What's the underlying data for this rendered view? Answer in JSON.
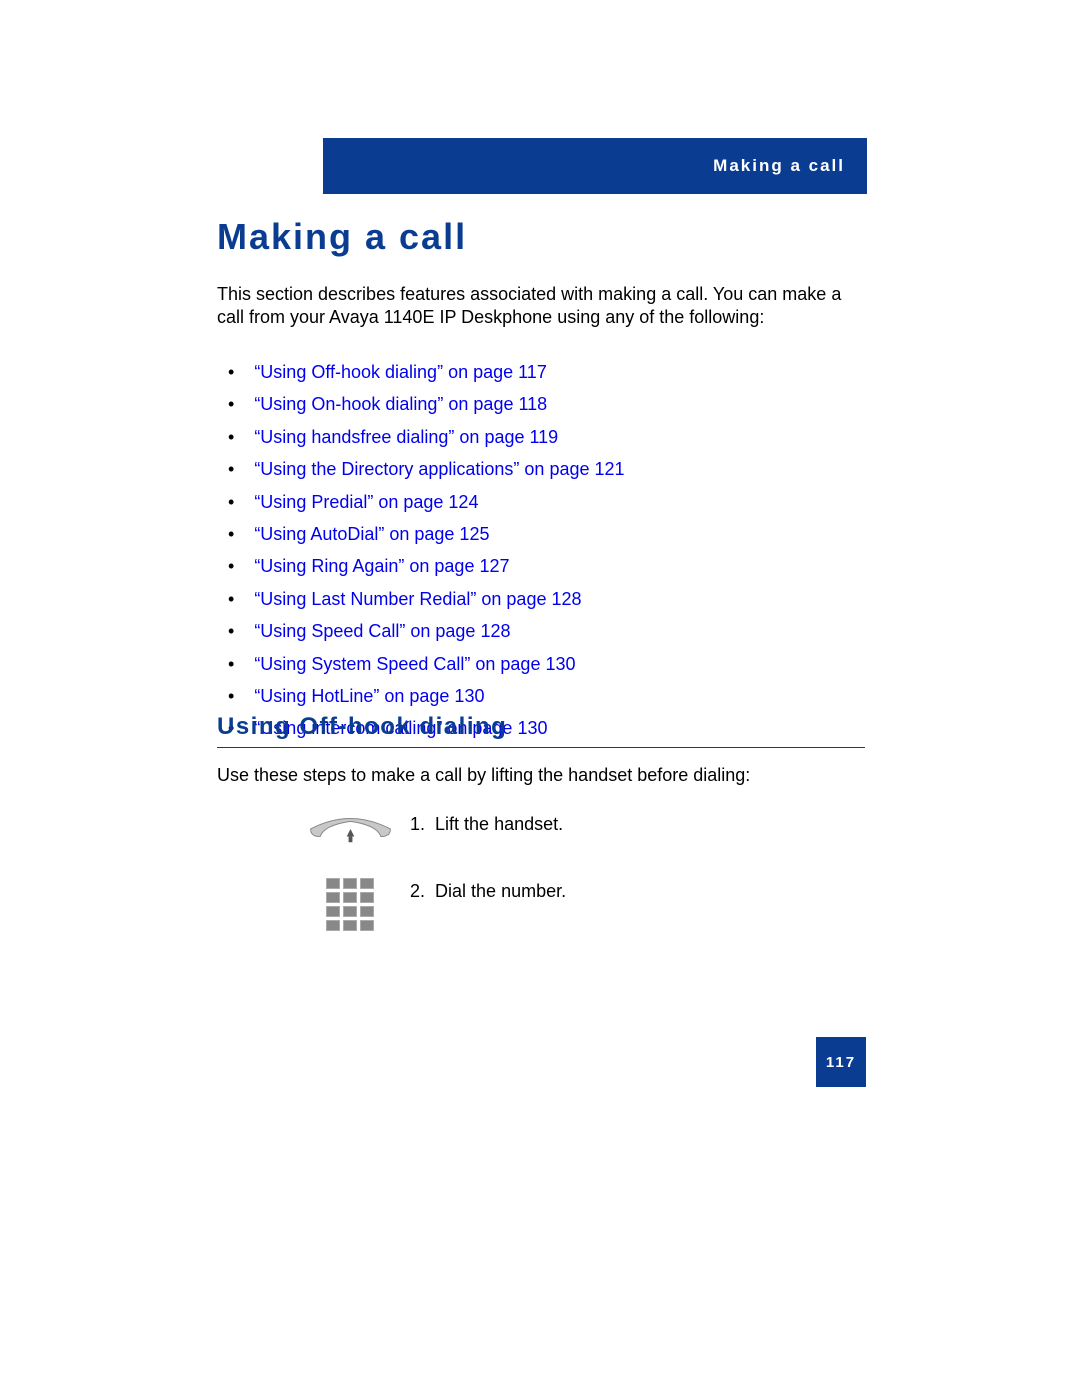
{
  "header": {
    "title": "Making a call"
  },
  "heading": "Making a call",
  "intro": "This section describes features associated with making a call. You can make a call from your Avaya 1140E IP Deskphone using any of the following:",
  "links": [
    "“Using Off-hook dialing” on page 117",
    "“Using On-hook dialing” on page 118",
    "“Using handsfree dialing” on page 119",
    "“Using the Directory applications” on page 121",
    "“Using Predial” on page 124",
    "“Using AutoDial” on page 125",
    "“Using Ring Again” on page 127",
    "“Using Last Number Redial” on page 128",
    "“Using Speed Call” on page 128",
    "“Using System Speed Call” on page 130",
    "“Using HotLine” on page 130",
    "“Using intercom calling” on page 130"
  ],
  "subheading": "Using Off-hook dialing",
  "subintro": "Use these steps to make a call by lifting the handset before dialing:",
  "steps": [
    {
      "num": "1.",
      "text": "Lift the handset."
    },
    {
      "num": "2.",
      "text": "Dial the number."
    }
  ],
  "page_number": "117"
}
